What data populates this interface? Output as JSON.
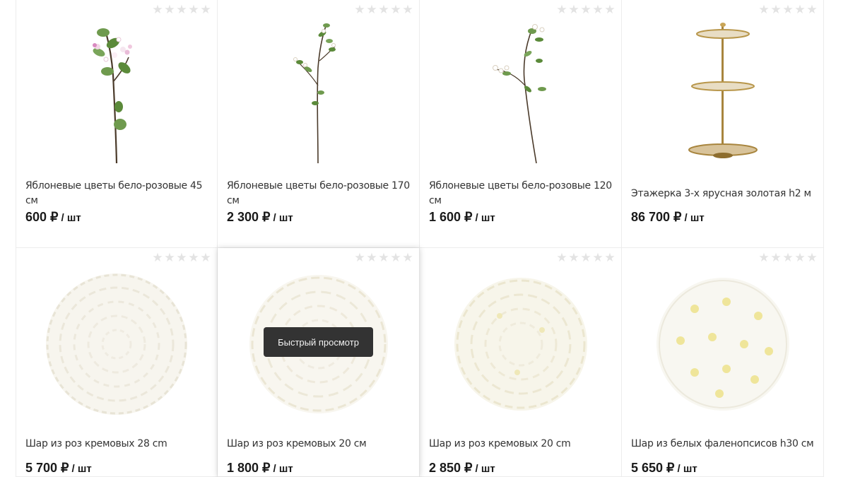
{
  "products": [
    {
      "name": "Яблоневые цветы бело-розовые 45 см",
      "price": "600 ₽",
      "unit": "/ шт",
      "image": "apple-blossom-branch-short",
      "rating": 0
    },
    {
      "name": "Яблоневые цветы бело-розовые 170 см",
      "price": "2 300 ₽",
      "unit": "/ шт",
      "image": "apple-blossom-branch-tall",
      "rating": 0
    },
    {
      "name": "Яблоневые цветы бело-розовые 120 см",
      "price": "1 600 ₽",
      "unit": "/ шт",
      "image": "apple-blossom-branch-medium",
      "rating": 0
    },
    {
      "name": "Этажерка 3-х ярусная золотая h2 м",
      "price": "86 700 ₽",
      "unit": "/ шт",
      "image": "gold-three-tier-stand",
      "rating": 0
    },
    {
      "name": "Шар из роз кремовых 28 cm",
      "price": "5 700 ₽",
      "unit": "/ шт",
      "image": "cream-rose-ball",
      "rating": 0
    },
    {
      "name": "Шар из роз кремовых 20 см",
      "price": "1 800 ₽",
      "unit": "/ шт",
      "image": "cream-rose-ball",
      "rating": 0
    },
    {
      "name": "Шар из роз кремовых 20 cm",
      "price": "2 850 ₽",
      "unit": "/ шт",
      "image": "cream-rose-ball",
      "rating": 0
    },
    {
      "name": "Шар из белых фаленопсисов h30 см",
      "price": "5 650 ₽",
      "unit": "/ шт",
      "image": "white-orchid-ball",
      "rating": 0
    }
  ],
  "quick_view_label": "Быстрый просмотр",
  "colors": {
    "star_empty": "#e3e3e3",
    "quick_view_bg": "#333333",
    "gold": "#b8964a"
  }
}
